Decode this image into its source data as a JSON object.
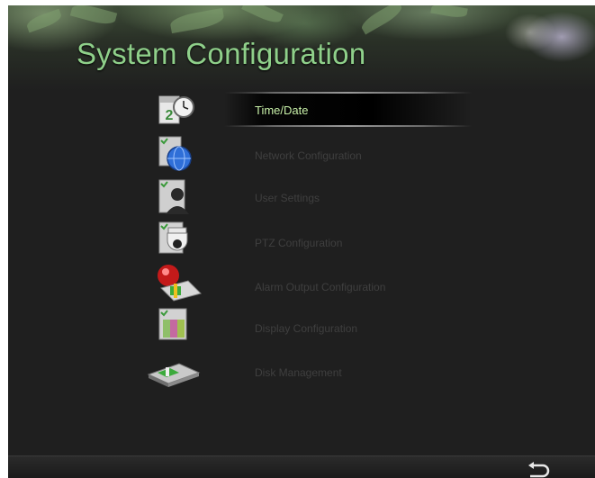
{
  "header": {
    "title": "System Configuration"
  },
  "menu": {
    "selected_index": 0,
    "items": [
      {
        "label": "Time/Date",
        "icon": "calendar-clock-icon"
      },
      {
        "label": "Network Configuration",
        "icon": "globe-network-icon"
      },
      {
        "label": "User Settings",
        "icon": "user-icon"
      },
      {
        "label": "PTZ Configuration",
        "icon": "ptz-camera-icon"
      },
      {
        "label": "Alarm Output Configuration",
        "icon": "alarm-light-icon"
      },
      {
        "label": "Display Configuration",
        "icon": "display-icon"
      },
      {
        "label": "Disk Management",
        "icon": "disk-icon"
      }
    ]
  },
  "footer": {
    "back_icon": "back-arrow-icon"
  },
  "colors": {
    "title": "#8fd08a",
    "selected_label": "#c8f0a8",
    "inactive_label": "#3f3f3f",
    "background": "#1f1f1f"
  }
}
